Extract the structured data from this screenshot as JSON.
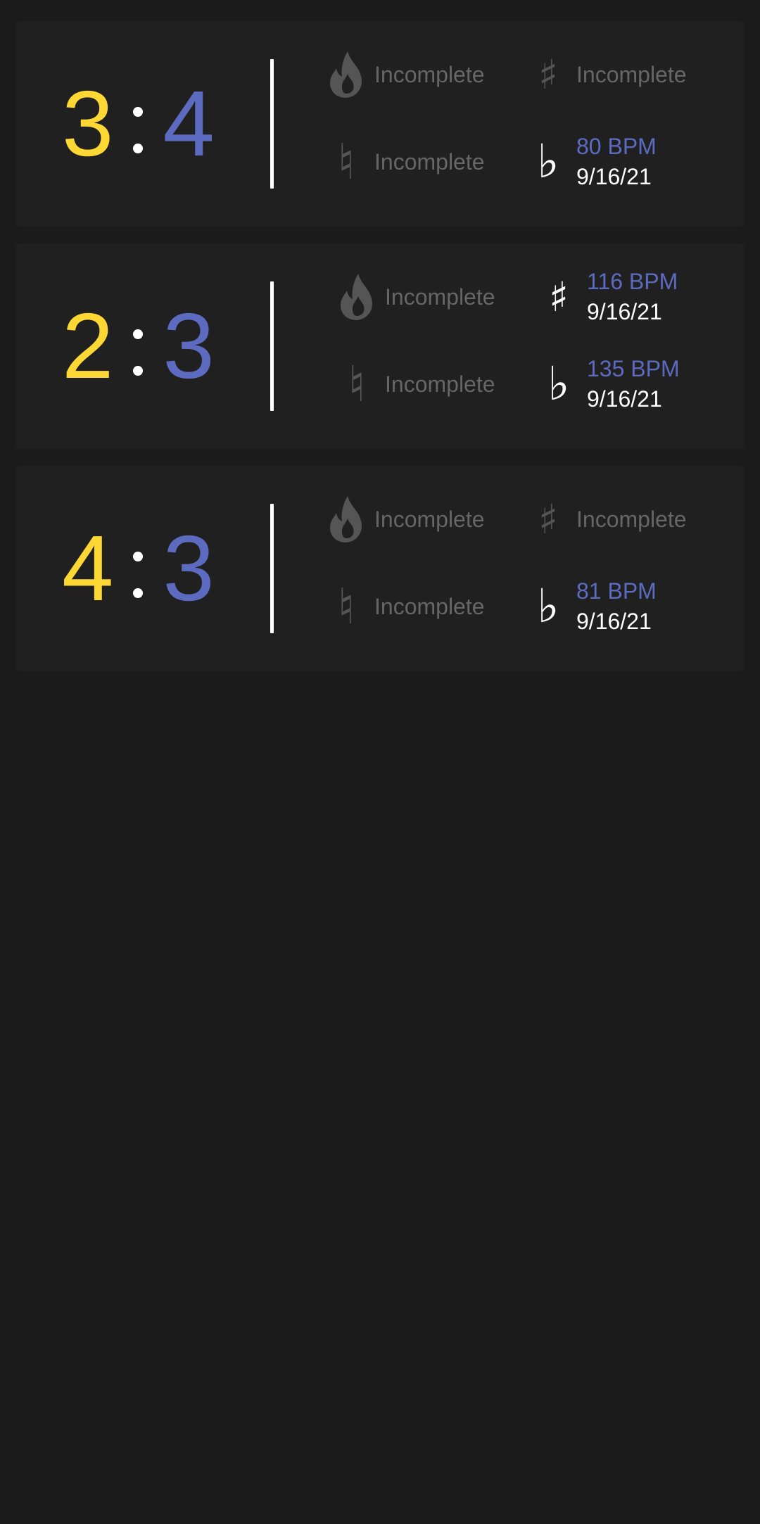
{
  "colors": {
    "background": "#1b1b1b",
    "card": "#202020",
    "left_number": "#fdd835",
    "right_number": "#5c6bc0",
    "incomplete_text": "#666666",
    "bpm_text": "#5c6bc0",
    "date_text": "#ffffff",
    "dim_icon": "#555555"
  },
  "cards": [
    {
      "left": "3",
      "right": "4",
      "fire": {
        "icon": "fire-icon",
        "status": "Incomplete"
      },
      "sharp": {
        "icon": "sharp-icon",
        "status": "Incomplete"
      },
      "natural": {
        "icon": "natural-icon",
        "status": "Incomplete"
      },
      "flat": {
        "icon": "flat-icon",
        "bpm": "80 BPM",
        "date": "9/16/21"
      }
    },
    {
      "left": "2",
      "right": "3",
      "fire": {
        "icon": "fire-icon",
        "status": "Incomplete"
      },
      "sharp": {
        "icon": "sharp-icon",
        "bpm": "116 BPM",
        "date": "9/16/21"
      },
      "natural": {
        "icon": "natural-icon",
        "status": "Incomplete"
      },
      "flat": {
        "icon": "flat-icon",
        "bpm": "135 BPM",
        "date": "9/16/21"
      }
    },
    {
      "left": "4",
      "right": "3",
      "fire": {
        "icon": "fire-icon",
        "status": "Incomplete"
      },
      "sharp": {
        "icon": "sharp-icon",
        "status": "Incomplete"
      },
      "natural": {
        "icon": "natural-icon",
        "status": "Incomplete"
      },
      "flat": {
        "icon": "flat-icon",
        "bpm": "81 BPM",
        "date": "9/16/21"
      }
    }
  ],
  "glyphs": {
    "sharp": "♯",
    "natural": "♮",
    "flat": "♭"
  }
}
